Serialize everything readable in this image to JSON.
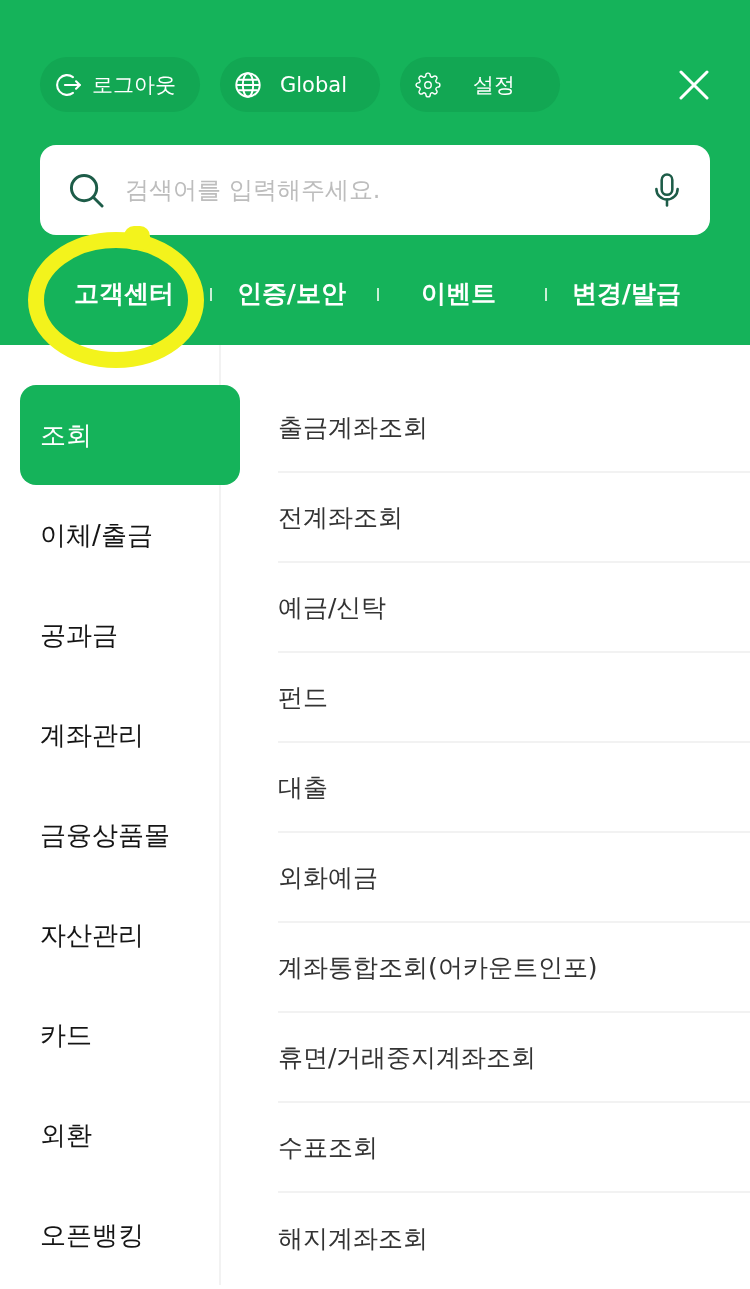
{
  "header": {
    "buttons": [
      {
        "kind": "logout",
        "label": "로그아웃"
      },
      {
        "kind": "language",
        "label": "Global"
      },
      {
        "kind": "settings",
        "label": "설정"
      }
    ]
  },
  "search": {
    "placeholder": "검색어를 입력해주세요."
  },
  "quick_links": [
    {
      "label": "고객센터",
      "highlighted": true
    },
    {
      "label": "인증/보안",
      "highlighted": false
    },
    {
      "label": "이벤트",
      "highlighted": false
    },
    {
      "label": "변경/발급",
      "highlighted": false
    }
  ],
  "sidebar": {
    "items": [
      {
        "label": "조회",
        "selected": true
      },
      {
        "label": "이체/출금",
        "selected": false
      },
      {
        "label": "공과금",
        "selected": false
      },
      {
        "label": "계좌관리",
        "selected": false
      },
      {
        "label": "금융상품몰",
        "selected": false
      },
      {
        "label": "자산관리",
        "selected": false
      },
      {
        "label": "카드",
        "selected": false
      },
      {
        "label": "외환",
        "selected": false
      },
      {
        "label": "오픈뱅킹",
        "selected": false
      }
    ]
  },
  "submenu": {
    "items": [
      "출금계좌조회",
      "전계좌조회",
      "예금/신탁",
      "펀드",
      "대출",
      "외화예금",
      "계좌통합조회(어카운트인포)",
      "휴면/거래중지계좌조회",
      "수표조회",
      "해지계좌조회"
    ]
  }
}
